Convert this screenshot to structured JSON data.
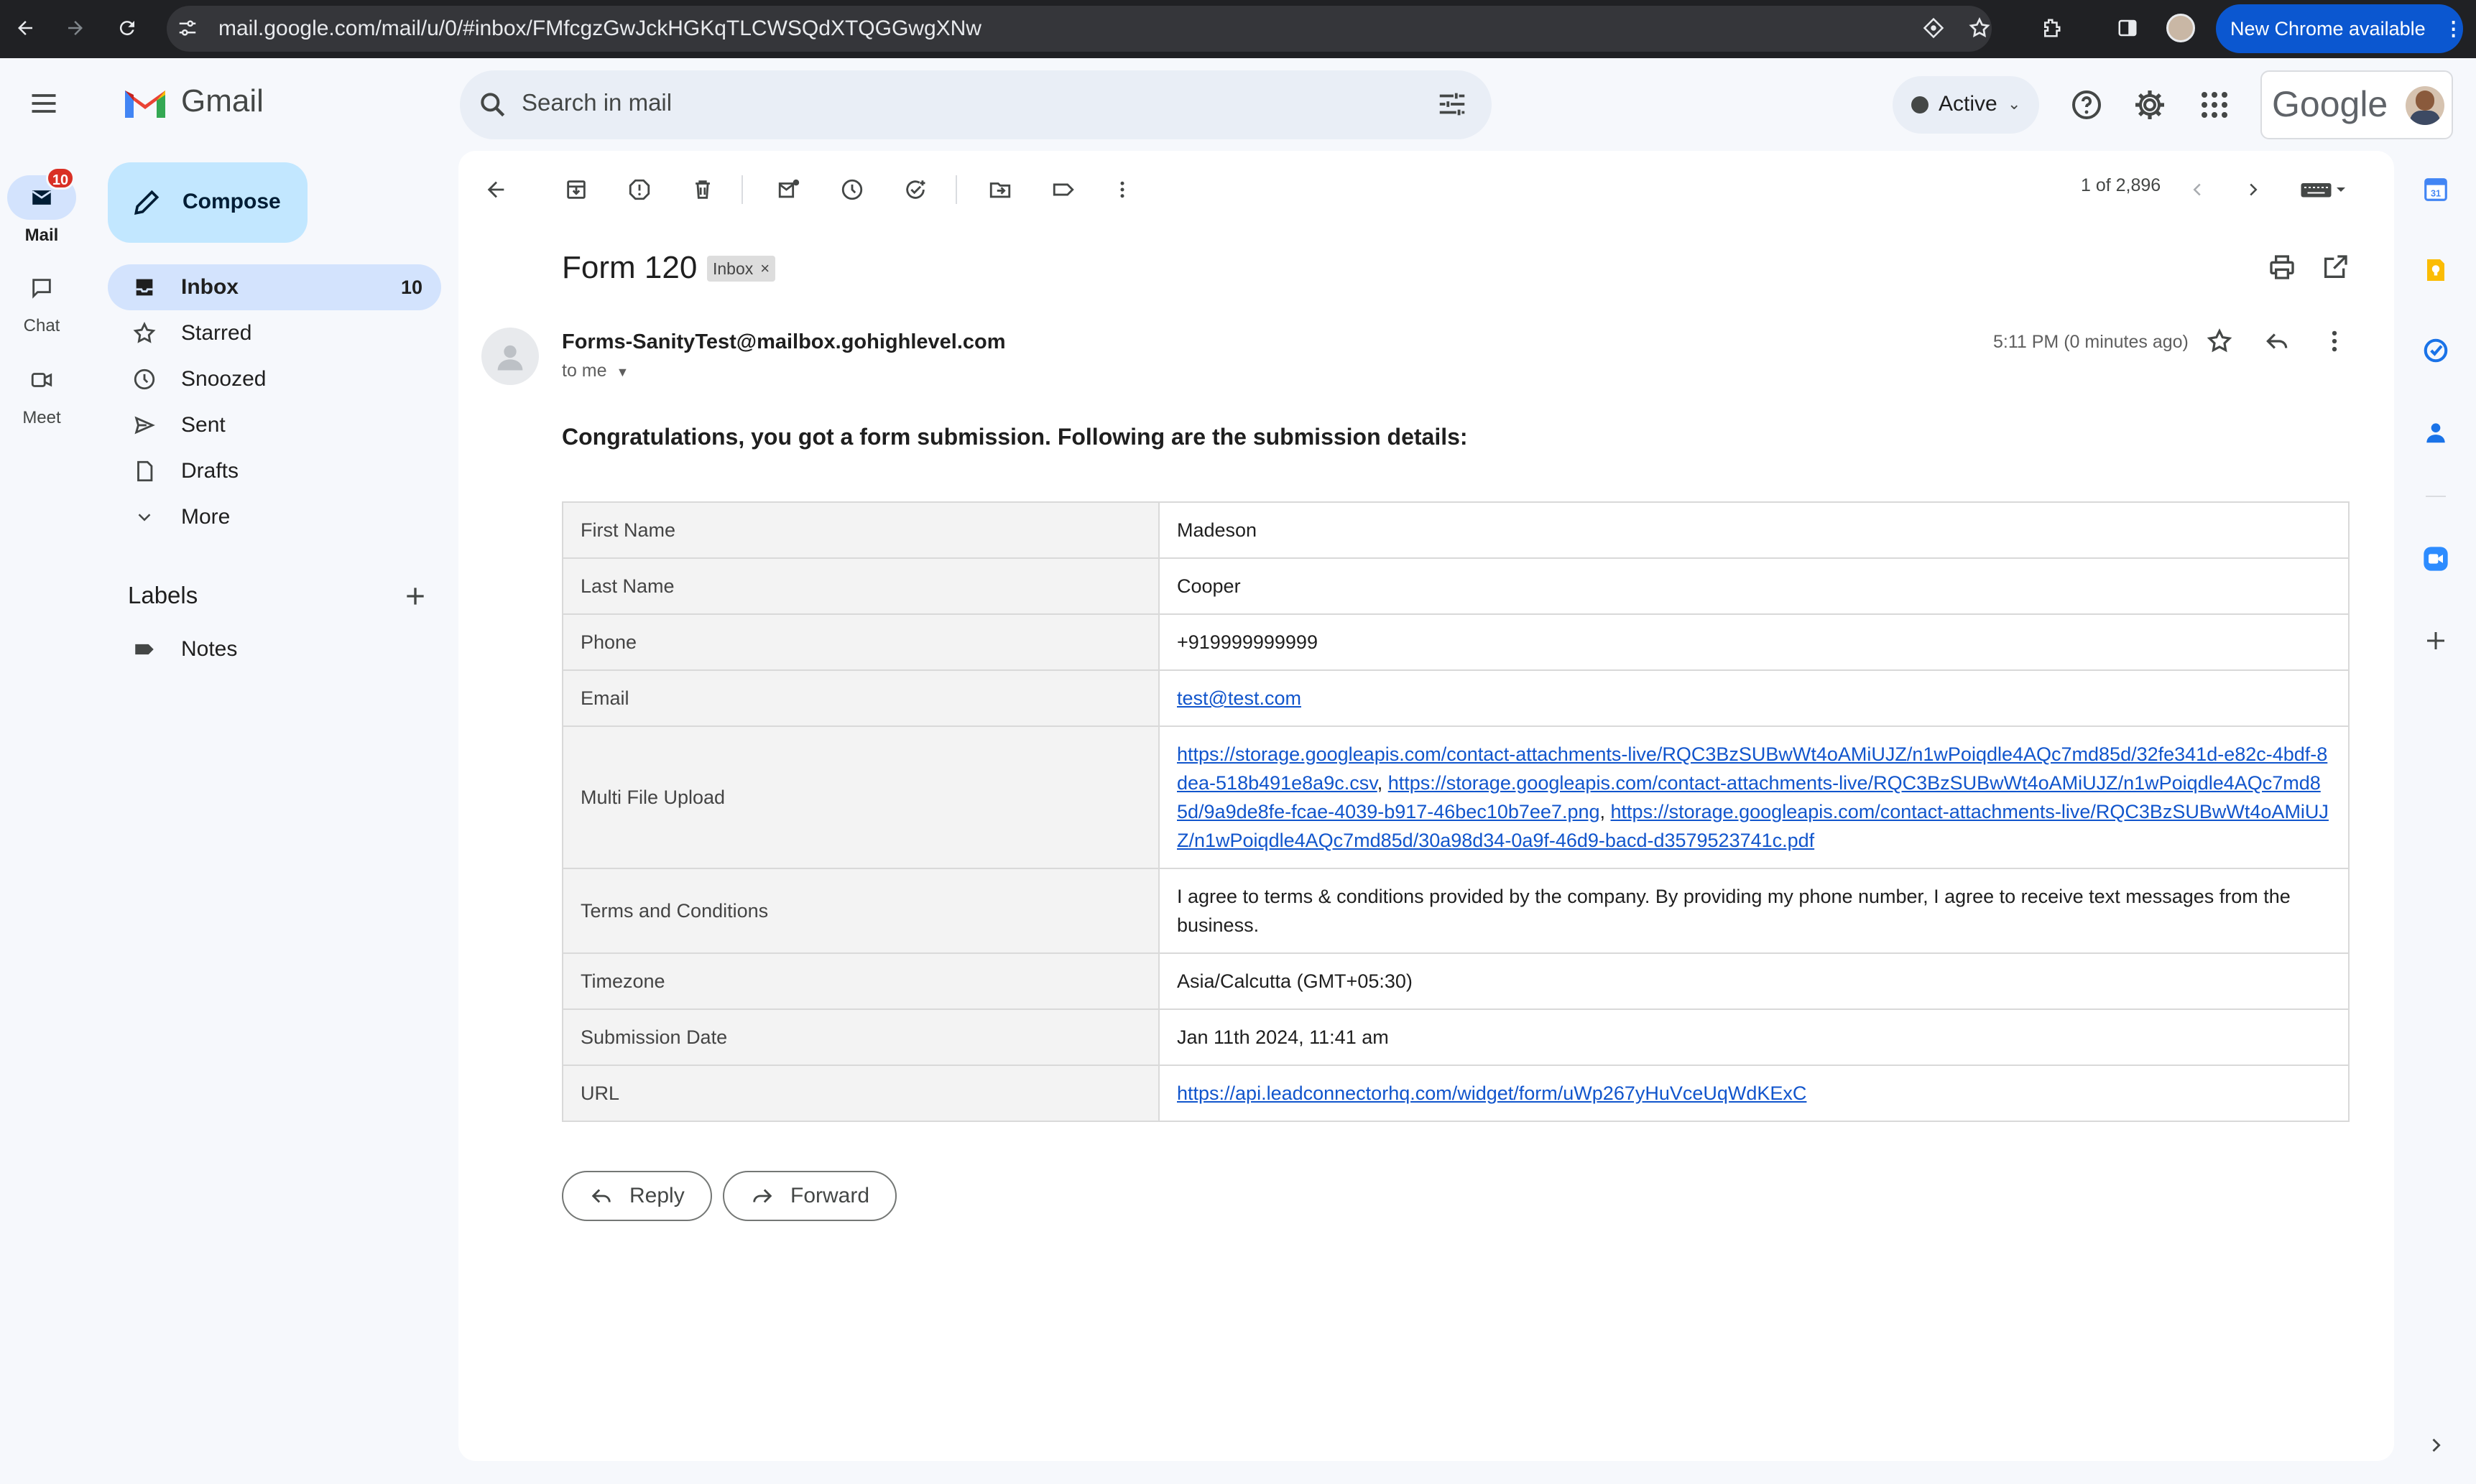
{
  "browser": {
    "url": "mail.google.com/mail/u/0/#inbox/FMfcgzGwJckHGKqTLCWSQdXTQGGwgXNw",
    "update_label": "New Chrome available"
  },
  "rail": {
    "mail_label": "Mail",
    "mail_badge": "10",
    "chat_label": "Chat",
    "meet_label": "Meet"
  },
  "header": {
    "app_name": "Gmail",
    "search_placeholder": "Search in mail",
    "status": "Active",
    "account_brand": "Google"
  },
  "nav": {
    "compose_label": "Compose",
    "items": [
      {
        "label": "Inbox",
        "count": "10"
      },
      {
        "label": "Starred"
      },
      {
        "label": "Snoozed"
      },
      {
        "label": "Sent"
      },
      {
        "label": "Drafts"
      },
      {
        "label": "More"
      }
    ],
    "labels_heading": "Labels",
    "user_labels": [
      {
        "label": "Notes"
      }
    ]
  },
  "toolbar": {
    "pagination": "1 of 2,896"
  },
  "message": {
    "subject": "Form 120",
    "chip": "Inbox",
    "sender": "Forms-SanityTest@mailbox.gohighlevel.com",
    "to": "to me",
    "time": "5:11 PM (0 minutes ago)",
    "intro": "Congratulations, you got a form submission. Following are the submission details:",
    "fields": {
      "first_name_label": "First Name",
      "first_name": "Madeson",
      "last_name_label": "Last Name",
      "last_name": "Cooper",
      "phone_label": "Phone",
      "phone": "+919999999999",
      "email_label": "Email",
      "email": "test@test.com",
      "upload_label": "Multi File Upload",
      "upload_link_1": "https://storage.googleapis.com/contact-attachments-live/RQC3BzSUBwWt4oAMiUJZ/n1wPoiqdle4AQc7md85d/32fe341d-e82c-4bdf-8dea-518b491e8a9c.csv",
      "upload_link_2": "https://storage.googleapis.com/contact-attachments-live/RQC3BzSUBwWt4oAMiUJZ/n1wPoiqdle4AQc7md85d/9a9de8fe-fcae-4039-b917-46bec10b7ee7.png",
      "upload_link_3": "https://storage.googleapis.com/contact-attachments-live/RQC3BzSUBwWt4oAMiUJZ/n1wPoiqdle4AQc7md85d/30a98d34-0a9f-46d9-bacd-d3579523741c.pdf",
      "terms_label": "Terms and Conditions",
      "terms": "I agree to terms & conditions provided by the company. By providing my phone number, I agree to receive text messages from the business.",
      "timezone_label": "Timezone",
      "timezone": "Asia/Calcutta (GMT+05:30)",
      "submission_date_label": "Submission Date",
      "submission_date": "Jan 11th 2024, 11:41 am",
      "url_label": "URL",
      "url": "https://api.leadconnectorhq.com/widget/form/uWp267yHuVceUqWdKExC"
    },
    "reply_label": "Reply",
    "forward_label": "Forward"
  }
}
